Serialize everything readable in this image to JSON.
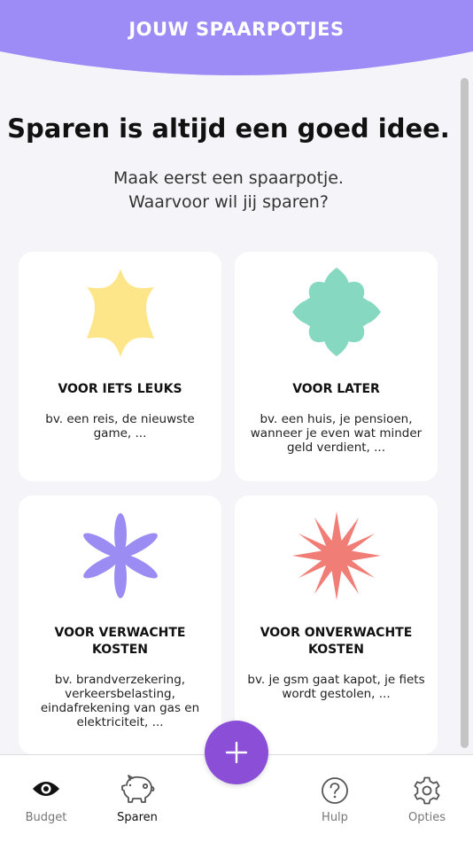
{
  "header": {
    "title": "JOUW SPAARPOTJES"
  },
  "main": {
    "headline": "Sparen is altijd een goed idee.",
    "sub_line1": "Maak eerst een spaarpotje.",
    "sub_line2": "Waarvoor wil jij sparen?"
  },
  "cards": [
    {
      "title": "VOOR IETS LEUKS",
      "description": "bv. een reis, de nieuwste game, ...",
      "shape_color": "#fde68a",
      "icon": "star-shape-icon"
    },
    {
      "title": "VOOR LATER",
      "description": "bv. een huis, je pensioen, wanneer je even wat minder geld verdient, ...",
      "shape_color": "#86d9c0",
      "icon": "clover-shape-icon"
    },
    {
      "title": "VOOR VERWACHTE KOSTEN",
      "description": "bv. brandverzekering, verkeersbelasting, eindafrekening van gas en elektriciteit, ...",
      "shape_color": "#9b8cf3",
      "icon": "flower-shape-icon"
    },
    {
      "title": "VOOR ONVERWACHTE KOSTEN",
      "description": "bv. je gsm gaat kapot, je fiets wordt gestolen, ...",
      "shape_color": "#f07e76",
      "icon": "burst-shape-icon"
    }
  ],
  "nav": [
    {
      "label": "Budget",
      "icon": "eye-icon"
    },
    {
      "label": "Sparen",
      "icon": "piggy-bank-icon",
      "active": true
    },
    {
      "label": "Hulp",
      "icon": "help-icon"
    },
    {
      "label": "Opties",
      "icon": "gear-icon"
    }
  ],
  "colors": {
    "header": "#9d8cf6",
    "fab": "#8a4fd6",
    "background": "#f5f4f8"
  }
}
